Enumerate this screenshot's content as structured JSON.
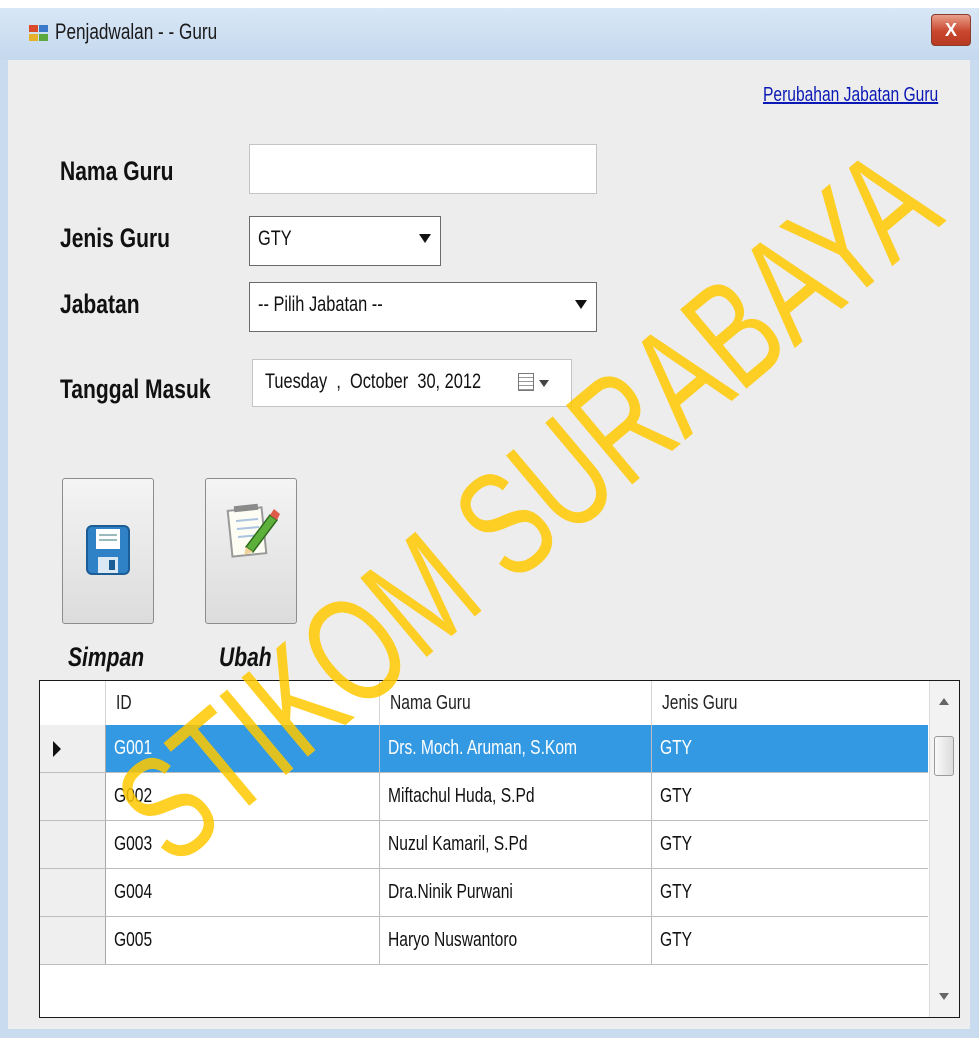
{
  "window": {
    "title": "Penjadwalan - - Guru",
    "close_label": "X"
  },
  "link": {
    "label": "Perubahan Jabatan Guru"
  },
  "form": {
    "nama_guru_label": "Nama Guru",
    "nama_guru_value": "",
    "jenis_guru_label": "Jenis Guru",
    "jenis_guru_value": "GTY",
    "jabatan_label": "Jabatan",
    "jabatan_value": "-- Pilih Jabatan --",
    "tanggal_masuk_label": "Tanggal Masuk",
    "tanggal_masuk_value": "Tuesday  ,  October  30, 2012"
  },
  "buttons": {
    "simpan_label": "Simpan",
    "ubah_label": "Ubah"
  },
  "grid": {
    "columns": [
      "ID",
      "Nama Guru",
      "Jenis Guru"
    ],
    "rows": [
      {
        "id": "G001",
        "nama": "Drs. Moch. Aruman, S.Kom",
        "jenis": "GTY",
        "selected": true
      },
      {
        "id": "G002",
        "nama": "Miftachul Huda, S.Pd",
        "jenis": "GTY",
        "selected": false
      },
      {
        "id": "G003",
        "nama": "Nuzul Kamaril, S.Pd",
        "jenis": "GTY",
        "selected": false
      },
      {
        "id": "G004",
        "nama": "Dra.Ninik Purwani",
        "jenis": "GTY",
        "selected": false
      },
      {
        "id": "G005",
        "nama": "Haryo Nuswantoro",
        "jenis": "GTY",
        "selected": false
      }
    ]
  },
  "watermark": {
    "text": "STIKOM SURABAYA",
    "color": "#ffc800"
  },
  "colors": {
    "selection": "#3299e2",
    "link": "#0a18b5",
    "client_bg": "#ededed"
  }
}
